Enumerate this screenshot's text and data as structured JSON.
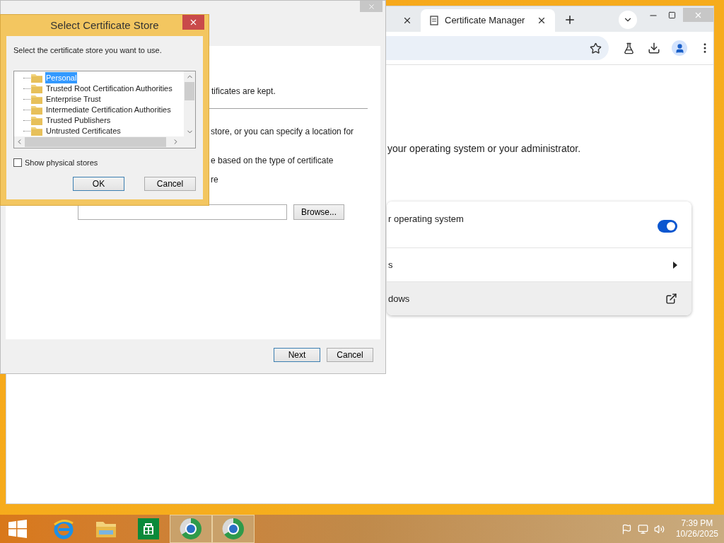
{
  "browser": {
    "tabs": [
      {
        "selected": false
      },
      {
        "label": "Certificate Manager",
        "selected": true
      }
    ],
    "page": {
      "intro": "your operating system or your administrator.",
      "rows": [
        {
          "kind": "toggle",
          "label": "r operating system",
          "on": true,
          "highlighted": false
        },
        {
          "kind": "link",
          "label": "s",
          "highlighted": false
        },
        {
          "kind": "external",
          "label": "dows",
          "highlighted": true
        }
      ]
    }
  },
  "wizard": {
    "lines": [
      "tificates are kept.",
      "store, or you can specify a location for",
      "e based on the type of certificate",
      "re"
    ],
    "browse_button": "Browse...",
    "buttons": [
      {
        "label": "Next",
        "default": true
      },
      {
        "label": "Cancel",
        "default": false
      }
    ]
  },
  "store_dialog": {
    "title": "Select Certificate Store",
    "prompt": "Select the certificate store you want to use.",
    "stores": [
      {
        "label": "Personal",
        "selected": true
      },
      {
        "label": "Trusted Root Certification Authorities",
        "selected": false
      },
      {
        "label": "Enterprise Trust",
        "selected": false
      },
      {
        "label": "Intermediate Certification Authorities",
        "selected": false
      },
      {
        "label": "Trusted Publishers",
        "selected": false
      },
      {
        "label": "Untrusted Certificates",
        "selected": false
      }
    ],
    "show_physical_stores": {
      "label": "Show physical stores",
      "checked": false
    },
    "buttons": [
      {
        "label": "OK",
        "default": true
      },
      {
        "label": "Cancel",
        "default": false
      }
    ]
  },
  "taskbar": {
    "apps": [
      {
        "kind": "ie",
        "selected": false
      },
      {
        "kind": "explorer",
        "selected": false
      },
      {
        "kind": "store",
        "selected": false
      },
      {
        "kind": "browser",
        "selected": true
      },
      {
        "kind": "browser",
        "selected": true
      }
    ],
    "time": "7:39 PM",
    "date": "10/26/2025"
  }
}
